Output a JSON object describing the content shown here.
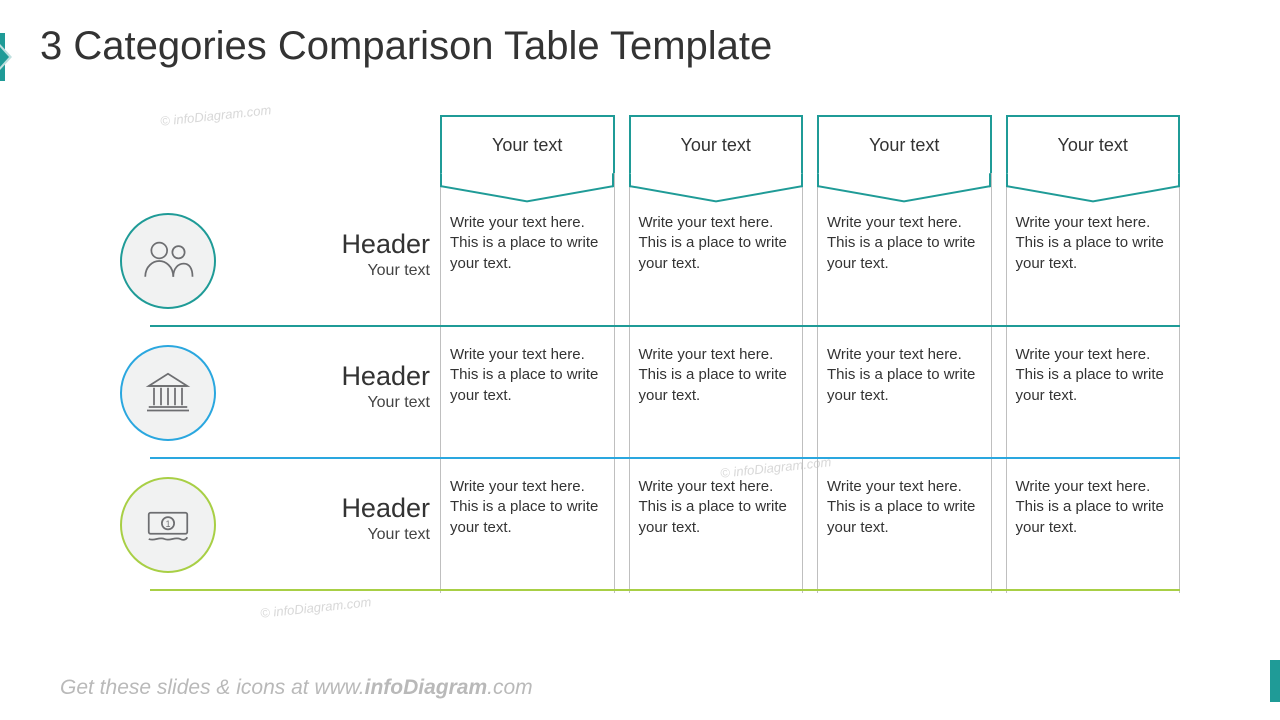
{
  "title": "3 Categories Comparison Table Template",
  "watermark": "© infoDiagram.com",
  "columns": [
    "Your text",
    "Your text",
    "Your text",
    "Your text"
  ],
  "rows": [
    {
      "color": "#1f9b97",
      "icon": "people-icon",
      "header": "Header",
      "subheader": "Your text",
      "cells": [
        "Write your text here. This is a place to write your text.",
        "Write your text here. This is a place to write your text.",
        "Write your text here. This is a place to write your text.",
        "Write your text here. This is a place to write your text."
      ]
    },
    {
      "color": "#2aa7df",
      "icon": "bank-icon",
      "header": "Header",
      "subheader": "Your text",
      "cells": [
        "Write your text here. This is a place to write your text.",
        "Write your text here. This is a place to write your text.",
        "Write your text here. This is a place to write your text.",
        "Write your text here. This is a place to write your text."
      ]
    },
    {
      "color": "#a8cf45",
      "icon": "money-icon",
      "header": "Header",
      "subheader": "Your text",
      "cells": [
        "Write your text here. This is a place to write your text.",
        "Write your text here. This is a place to write your text.",
        "Write your text here. This is a place to write your text.",
        "Write your text here. This is a place to write your text."
      ]
    }
  ],
  "footer_prefix": "Get these slides & icons at www.",
  "footer_bold": "infoDiagram",
  "footer_suffix": ".com"
}
